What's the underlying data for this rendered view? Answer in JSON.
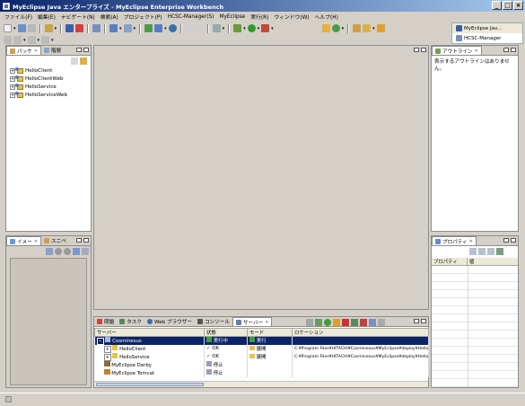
{
  "window": {
    "title": "MyEclipse Java エンタープライズ - MyEclipse Enterprise Workbench"
  },
  "menu": [
    "ファイル(F)",
    "編集(E)",
    "ナビゲート(N)",
    "検索(A)",
    "プロジェクト(P)",
    "HCSC-Manager(S)",
    "MyEclipse",
    "実行(R)",
    "ウィンドウ(W)",
    "ヘルプ(H)"
  ],
  "perspectives": {
    "items": [
      "MyEclipse Jav...",
      "HCSC-Manager"
    ]
  },
  "package_panel": {
    "tabs": [
      "パッケ",
      "階層"
    ],
    "projects": [
      "HelloClient",
      "HelloClientWeb",
      "HelloService",
      "HelloServiceWeb"
    ]
  },
  "image_panel": {
    "tabs": [
      "イメー",
      "スニペ"
    ]
  },
  "outline_panel": {
    "tab": "アウトライン",
    "message": "表示するアウトラインはありません。"
  },
  "properties_panel": {
    "tab": "プロパティ",
    "columns": [
      "プロパティ",
      "値"
    ]
  },
  "bottom_panel": {
    "tabs": [
      "問題",
      "タスク",
      "Web ブラウザー",
      "コンソール",
      "サーバー"
    ],
    "columns": [
      "サーバー",
      "状態",
      "モード",
      "ロケーション"
    ],
    "rows": [
      {
        "name": "Cosminexus",
        "state": "実行中",
        "mode": "実行",
        "location": ""
      },
      {
        "name": "HelloClient",
        "state": "OK",
        "mode": "展開",
        "location": "C:¥Program Files¥HITACHI¥Cosminexus¥MyEclipse¥deploy¥Hello"
      },
      {
        "name": "HelloService",
        "state": "OK",
        "mode": "展開",
        "location": "C:¥Program Files¥HITACHI¥Cosminexus¥MyEclipse¥deploy¥Hello"
      },
      {
        "name": "MyEclipse Derby",
        "state": "停止",
        "mode": "",
        "location": ""
      },
      {
        "name": "MyEclipse Tomcat",
        "state": "停止",
        "mode": "",
        "location": ""
      }
    ]
  },
  "colors": {
    "title_start": "#0a246a",
    "title_end": "#a6caf0",
    "selection": "#0a246a"
  }
}
